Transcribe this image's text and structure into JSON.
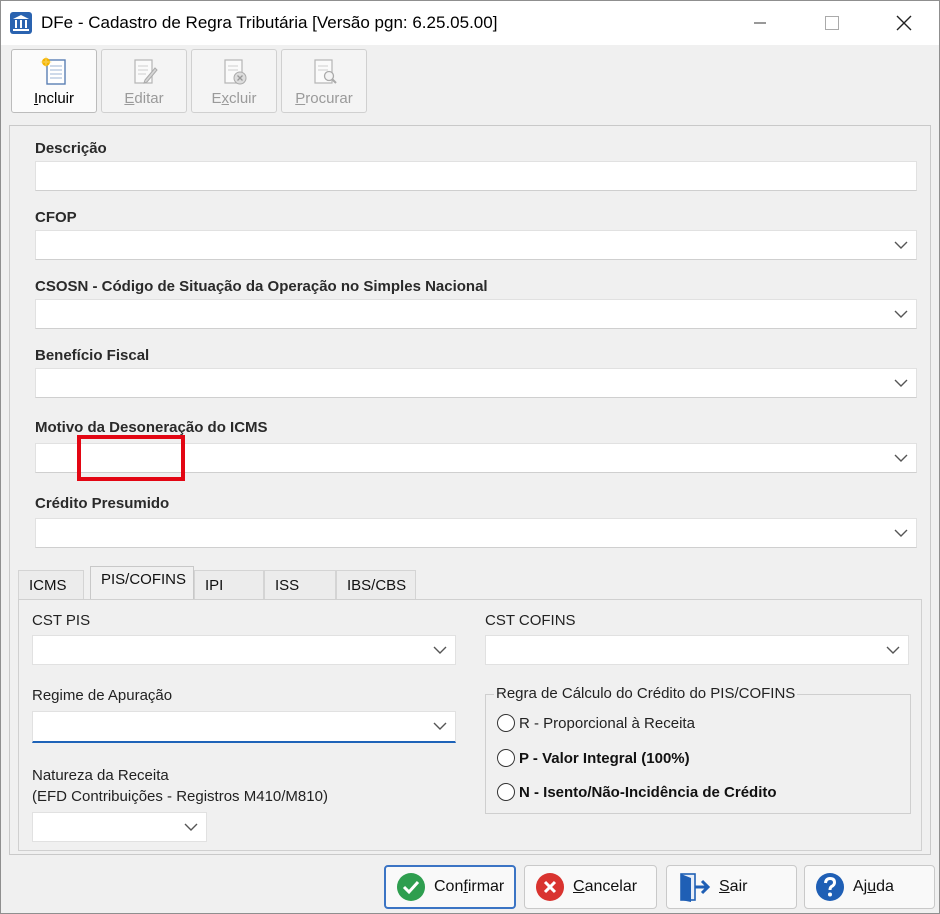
{
  "window": {
    "title": "DFe - Cadastro de Regra Tributária [Versão pgn: 6.25.05.00]"
  },
  "toolbar": {
    "incluir": {
      "pre": "",
      "u": "I",
      "post": "ncluir"
    },
    "editar": {
      "pre": "",
      "u": "E",
      "post": "ditar"
    },
    "excluir": {
      "pre": "E",
      "u": "x",
      "post": "cluir"
    },
    "procurar": {
      "pre": "",
      "u": "P",
      "post": "rocurar"
    }
  },
  "form": {
    "descricao_label": "Descrição",
    "descricao_value": "",
    "cfop_label": "CFOP",
    "cfop_value": "",
    "csosn_label": "CSOSN - Código de Situação da Operação no Simples Nacional",
    "csosn_value": "",
    "beneficio_label": "Benefício Fiscal",
    "beneficio_value": "",
    "motivo_label": "Motivo da Desoneração do ICMS",
    "motivo_value": "",
    "credito_label": "Crédito Presumido",
    "credito_value": ""
  },
  "tabs": [
    {
      "label": "ICMS"
    },
    {
      "label": "PIS/COFINS"
    },
    {
      "label": "IPI"
    },
    {
      "label": "ISS"
    },
    {
      "label": "IBS/CBS"
    }
  ],
  "selected_tab": "PIS/COFINS",
  "pis_cofins": {
    "cst_pis_label": "CST PIS",
    "cst_cofins_label": "CST COFINS",
    "regime_label": "Regime de Apuração",
    "natureza_label_line1": "Natureza da Receita",
    "natureza_label_line2": "(EFD Contribuições - Registros M410/M810)",
    "regra_group_title": "Regra de Cálculo do Crédito do PIS/COFINS",
    "radio_options": [
      {
        "label": "R - Proporcional à Receita",
        "selected": false
      },
      {
        "label": "P - Valor Integral (100%)",
        "selected": false
      },
      {
        "label": "N - Isento/Não-Incidência de Crédito",
        "selected": false
      }
    ]
  },
  "footer": {
    "confirmar": {
      "pre": "Con",
      "u": "f",
      "post": "irmar"
    },
    "cancelar": {
      "pre": "",
      "u": "C",
      "post": "ancelar"
    },
    "sair": {
      "pre": "",
      "u": "S",
      "post": "air"
    },
    "ajuda": {
      "pre": "Aj",
      "u": "u",
      "post": "da"
    }
  },
  "colors": {
    "highlight": "#e30613",
    "focus_underline": "#1e63b8",
    "confirm_green": "#2e9e4f",
    "cancel_red": "#d9332f",
    "help_blue": "#1f5fb5"
  }
}
